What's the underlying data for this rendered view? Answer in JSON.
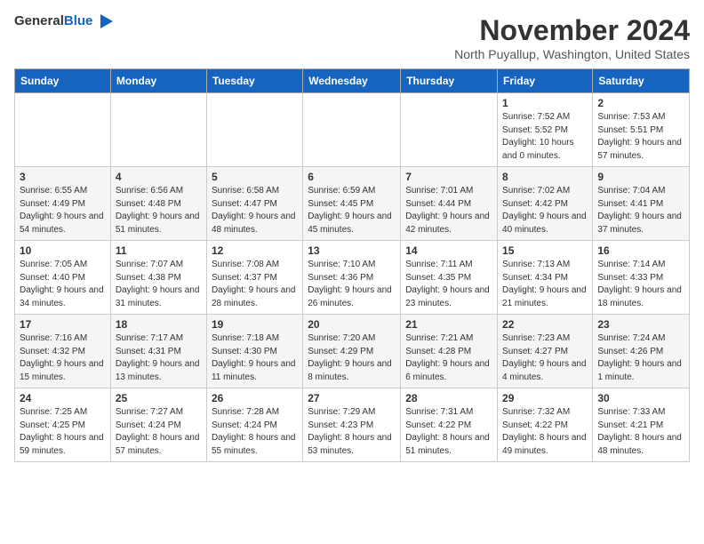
{
  "header": {
    "logo_line1": "General",
    "logo_line2": "Blue",
    "month": "November 2024",
    "location": "North Puyallup, Washington, United States"
  },
  "days_of_week": [
    "Sunday",
    "Monday",
    "Tuesday",
    "Wednesday",
    "Thursday",
    "Friday",
    "Saturday"
  ],
  "weeks": [
    [
      {
        "day": "",
        "info": ""
      },
      {
        "day": "",
        "info": ""
      },
      {
        "day": "",
        "info": ""
      },
      {
        "day": "",
        "info": ""
      },
      {
        "day": "",
        "info": ""
      },
      {
        "day": "1",
        "info": "Sunrise: 7:52 AM\nSunset: 5:52 PM\nDaylight: 10 hours and 0 minutes."
      },
      {
        "day": "2",
        "info": "Sunrise: 7:53 AM\nSunset: 5:51 PM\nDaylight: 9 hours and 57 minutes."
      }
    ],
    [
      {
        "day": "3",
        "info": "Sunrise: 6:55 AM\nSunset: 4:49 PM\nDaylight: 9 hours and 54 minutes."
      },
      {
        "day": "4",
        "info": "Sunrise: 6:56 AM\nSunset: 4:48 PM\nDaylight: 9 hours and 51 minutes."
      },
      {
        "day": "5",
        "info": "Sunrise: 6:58 AM\nSunset: 4:47 PM\nDaylight: 9 hours and 48 minutes."
      },
      {
        "day": "6",
        "info": "Sunrise: 6:59 AM\nSunset: 4:45 PM\nDaylight: 9 hours and 45 minutes."
      },
      {
        "day": "7",
        "info": "Sunrise: 7:01 AM\nSunset: 4:44 PM\nDaylight: 9 hours and 42 minutes."
      },
      {
        "day": "8",
        "info": "Sunrise: 7:02 AM\nSunset: 4:42 PM\nDaylight: 9 hours and 40 minutes."
      },
      {
        "day": "9",
        "info": "Sunrise: 7:04 AM\nSunset: 4:41 PM\nDaylight: 9 hours and 37 minutes."
      }
    ],
    [
      {
        "day": "10",
        "info": "Sunrise: 7:05 AM\nSunset: 4:40 PM\nDaylight: 9 hours and 34 minutes."
      },
      {
        "day": "11",
        "info": "Sunrise: 7:07 AM\nSunset: 4:38 PM\nDaylight: 9 hours and 31 minutes."
      },
      {
        "day": "12",
        "info": "Sunrise: 7:08 AM\nSunset: 4:37 PM\nDaylight: 9 hours and 28 minutes."
      },
      {
        "day": "13",
        "info": "Sunrise: 7:10 AM\nSunset: 4:36 PM\nDaylight: 9 hours and 26 minutes."
      },
      {
        "day": "14",
        "info": "Sunrise: 7:11 AM\nSunset: 4:35 PM\nDaylight: 9 hours and 23 minutes."
      },
      {
        "day": "15",
        "info": "Sunrise: 7:13 AM\nSunset: 4:34 PM\nDaylight: 9 hours and 21 minutes."
      },
      {
        "day": "16",
        "info": "Sunrise: 7:14 AM\nSunset: 4:33 PM\nDaylight: 9 hours and 18 minutes."
      }
    ],
    [
      {
        "day": "17",
        "info": "Sunrise: 7:16 AM\nSunset: 4:32 PM\nDaylight: 9 hours and 15 minutes."
      },
      {
        "day": "18",
        "info": "Sunrise: 7:17 AM\nSunset: 4:31 PM\nDaylight: 9 hours and 13 minutes."
      },
      {
        "day": "19",
        "info": "Sunrise: 7:18 AM\nSunset: 4:30 PM\nDaylight: 9 hours and 11 minutes."
      },
      {
        "day": "20",
        "info": "Sunrise: 7:20 AM\nSunset: 4:29 PM\nDaylight: 9 hours and 8 minutes."
      },
      {
        "day": "21",
        "info": "Sunrise: 7:21 AM\nSunset: 4:28 PM\nDaylight: 9 hours and 6 minutes."
      },
      {
        "day": "22",
        "info": "Sunrise: 7:23 AM\nSunset: 4:27 PM\nDaylight: 9 hours and 4 minutes."
      },
      {
        "day": "23",
        "info": "Sunrise: 7:24 AM\nSunset: 4:26 PM\nDaylight: 9 hours and 1 minute."
      }
    ],
    [
      {
        "day": "24",
        "info": "Sunrise: 7:25 AM\nSunset: 4:25 PM\nDaylight: 8 hours and 59 minutes."
      },
      {
        "day": "25",
        "info": "Sunrise: 7:27 AM\nSunset: 4:24 PM\nDaylight: 8 hours and 57 minutes."
      },
      {
        "day": "26",
        "info": "Sunrise: 7:28 AM\nSunset: 4:24 PM\nDaylight: 8 hours and 55 minutes."
      },
      {
        "day": "27",
        "info": "Sunrise: 7:29 AM\nSunset: 4:23 PM\nDaylight: 8 hours and 53 minutes."
      },
      {
        "day": "28",
        "info": "Sunrise: 7:31 AM\nSunset: 4:22 PM\nDaylight: 8 hours and 51 minutes."
      },
      {
        "day": "29",
        "info": "Sunrise: 7:32 AM\nSunset: 4:22 PM\nDaylight: 8 hours and 49 minutes."
      },
      {
        "day": "30",
        "info": "Sunrise: 7:33 AM\nSunset: 4:21 PM\nDaylight: 8 hours and 48 minutes."
      }
    ]
  ]
}
